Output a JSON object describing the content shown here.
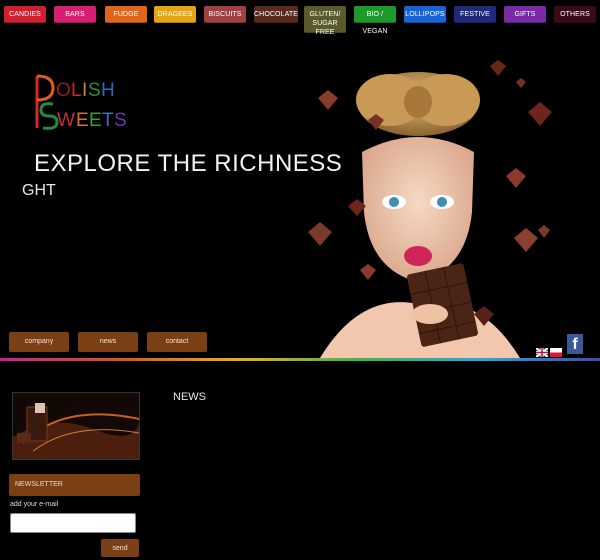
{
  "nav": [
    {
      "label": "CANDIES",
      "color": "#d11f2f"
    },
    {
      "label": "BARS",
      "color": "#d61f6e"
    },
    {
      "label": "FUDGE",
      "color": "#e0651b"
    },
    {
      "label": "DRAGEES",
      "color": "#e6a410"
    },
    {
      "label": "BISCUITS",
      "color": "#a04040"
    },
    {
      "label": "CHOCOLATE",
      "color": "#5a2a1d"
    },
    {
      "label_line1": "GLUTEN/",
      "label_line2": "SUGAR FREE",
      "color": "#5a5a2a"
    },
    {
      "label": "BIO / VEGAN",
      "color": "#1d9a2a"
    },
    {
      "label": "LOLLIPOPS",
      "color": "#1664d8"
    },
    {
      "label": "FESTIVE",
      "color": "#1e2a7a"
    },
    {
      "label": "GIFTS",
      "color": "#7a2ca8"
    },
    {
      "label": "OTHERS",
      "color": "#3a0a1a"
    }
  ],
  "hero": {
    "slogan": "EXPLORE THE RICHNESS",
    "slogan_cont": "GHT",
    "subnav": [
      "company",
      "news",
      "contact"
    ]
  },
  "sidebar": {
    "newsletter_title": "NEWSLETTER",
    "email_prompt": "add your e-mail",
    "email_value": "",
    "send_label": "send"
  },
  "main": {
    "news_heading": "NEWS"
  },
  "social": {
    "facebook_glyph": "f"
  }
}
